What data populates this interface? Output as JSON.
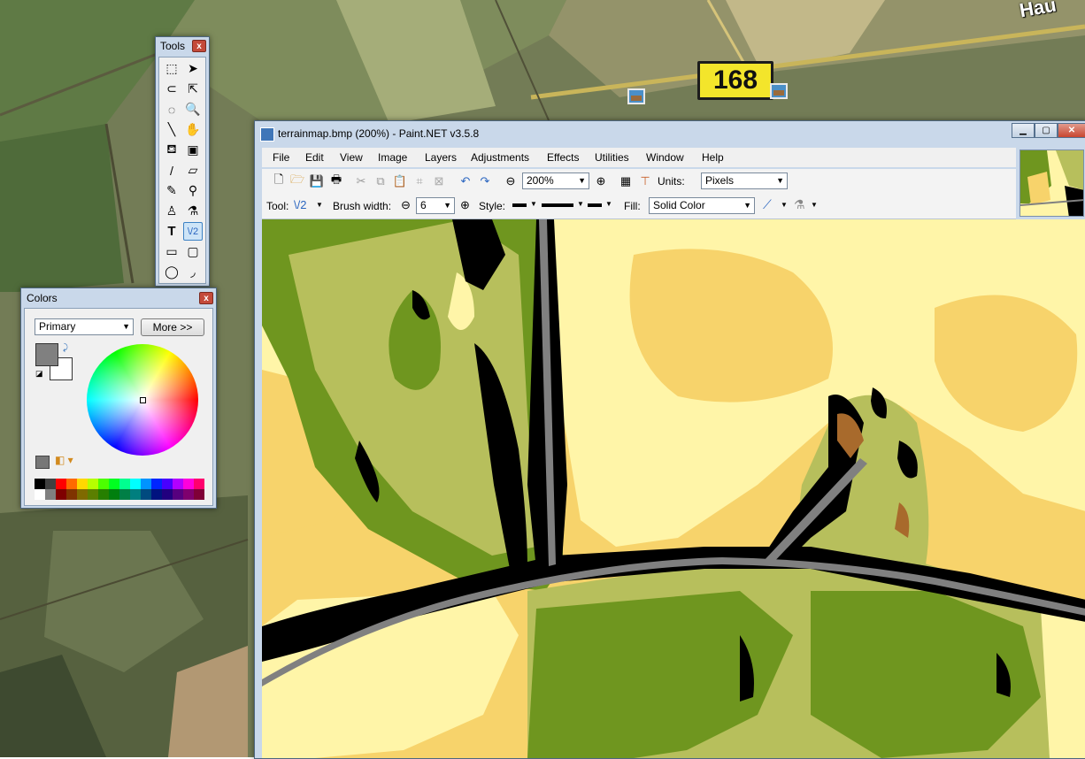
{
  "desktop": {
    "route_sign": "168",
    "street_label": "Hau"
  },
  "tools_palette": {
    "title": "Tools",
    "close_glyph": "x",
    "tools": [
      {
        "name": "rectangle-select-icon",
        "glyph": "⬚"
      },
      {
        "name": "move-selection-icon",
        "glyph": "➤"
      },
      {
        "name": "lasso-select-icon",
        "glyph": "⊂"
      },
      {
        "name": "move-selected-icon",
        "glyph": "⇱"
      },
      {
        "name": "ellipse-select-icon",
        "glyph": "◌"
      },
      {
        "name": "zoom-icon",
        "glyph": "🔍"
      },
      {
        "name": "magic-wand-icon",
        "glyph": "╲"
      },
      {
        "name": "pan-icon",
        "glyph": "✋"
      },
      {
        "name": "paint-bucket-icon",
        "glyph": "⛾"
      },
      {
        "name": "gradient-icon",
        "glyph": "▣"
      },
      {
        "name": "paintbrush-icon",
        "glyph": "/"
      },
      {
        "name": "eraser-icon",
        "glyph": "▱"
      },
      {
        "name": "pencil-icon",
        "glyph": "✎"
      },
      {
        "name": "color-picker-icon",
        "glyph": "⚲"
      },
      {
        "name": "clone-stamp-icon",
        "glyph": "♙"
      },
      {
        "name": "recolor-icon",
        "glyph": "⚗"
      },
      {
        "name": "text-icon",
        "glyph": "T"
      },
      {
        "name": "line-curve-icon",
        "glyph": "\\/2"
      },
      {
        "name": "rectangle-icon",
        "glyph": "▭"
      },
      {
        "name": "rounded-rectangle-icon",
        "glyph": "▢"
      },
      {
        "name": "ellipse-icon",
        "glyph": "◯"
      },
      {
        "name": "freeform-shape-icon",
        "glyph": "◞"
      }
    ],
    "active_tool_index": 17
  },
  "colors_palette": {
    "title": "Colors",
    "close_glyph": "x",
    "mode_select": "Primary",
    "more_button": "More >>",
    "primary_color": "#808080",
    "secondary_color": "#ffffff",
    "palette": [
      "#000000",
      "#404040",
      "#ff0000",
      "#ff6a00",
      "#ffd800",
      "#b6ff00",
      "#4cff00",
      "#00ff21",
      "#00ff90",
      "#00ffff",
      "#0094ff",
      "#0026ff",
      "#4800ff",
      "#b200ff",
      "#ff00dc",
      "#ff006e",
      "#ffffff",
      "#808080",
      "#7f0000",
      "#7f3300",
      "#7f6a00",
      "#5b7f00",
      "#267f00",
      "#007f0e",
      "#007f46",
      "#007f7f",
      "#004a7f",
      "#00137f",
      "#21007f",
      "#57007f",
      "#7f006e",
      "#7f0037"
    ]
  },
  "main_window": {
    "title": "terrainmap.bmp (200%) - Paint.NET v3.5.8",
    "menu": [
      "File",
      "Edit",
      "View",
      "Image",
      "Layers",
      "Adjustments",
      "Effects",
      "Utilities",
      "Window",
      "Help"
    ],
    "zoom_value": "200%",
    "units_label": "Units:",
    "units_value": "Pixels",
    "tool_label": "Tool:",
    "tool_glyph": "\\/2",
    "brush_width_label": "Brush width:",
    "brush_width_value": "6",
    "style_label": "Style:",
    "fill_label": "Fill:",
    "fill_value": "Solid Color"
  },
  "colors_theme": {
    "terrain_pale": "#fff5a8",
    "terrain_yellow": "#f7d36b",
    "terrain_olive": "#b7bf5c",
    "terrain_green": "#6f961f",
    "terrain_brown": "#a86a2c",
    "terrain_road": "#808080",
    "terrain_black": "#000000"
  }
}
